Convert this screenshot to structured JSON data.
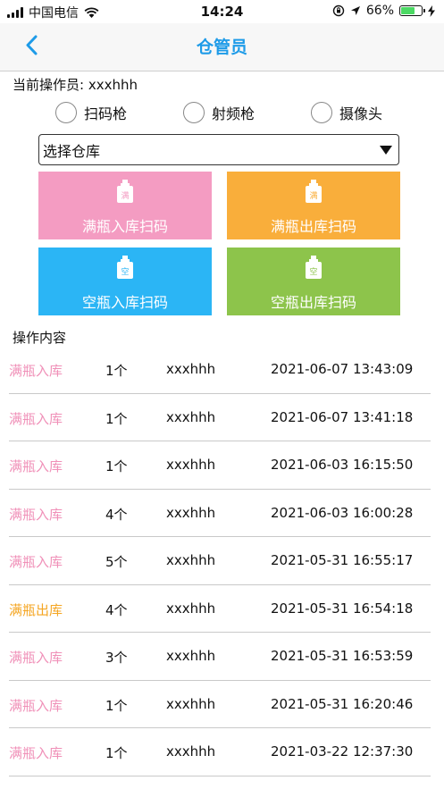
{
  "status_bar": {
    "carrier": "中国电信",
    "time": "14:24",
    "battery": "66%",
    "battery_level": 0.66
  },
  "nav": {
    "title": "仓管员",
    "back_icon": "chevron-left-icon"
  },
  "operator": {
    "label": "当前操作员: xxxhhh"
  },
  "scan_modes": [
    {
      "label": "扫码枪",
      "selected": false
    },
    {
      "label": "射频枪",
      "selected": false
    },
    {
      "label": "摄像头",
      "selected": false
    }
  ],
  "warehouse_select": {
    "value": "选择仓库"
  },
  "tiles": [
    {
      "label": "满瓶入库扫码",
      "badge": "满",
      "color": "#f49cc2"
    },
    {
      "label": "满瓶出库扫码",
      "badge": "满",
      "color": "#f9ae3b"
    },
    {
      "label": "空瓶入库扫码",
      "badge": "空",
      "color": "#2bb5f5"
    },
    {
      "label": "空瓶出库扫码",
      "badge": "空",
      "color": "#8dc44b"
    }
  ],
  "records_section": {
    "title": "操作内容"
  },
  "colors": {
    "in": "#f090b8",
    "out": "#f5a623",
    "accent": "#1e9be8"
  },
  "records": [
    {
      "type": "满瓶入库",
      "kind": "in",
      "qty": "1个",
      "user": "xxxhhh",
      "time": "2021-06-07 13:43:09"
    },
    {
      "type": "满瓶入库",
      "kind": "in",
      "qty": "1个",
      "user": "xxxhhh",
      "time": "2021-06-07 13:41:18"
    },
    {
      "type": "满瓶入库",
      "kind": "in",
      "qty": "1个",
      "user": "xxxhhh",
      "time": "2021-06-03 16:15:50"
    },
    {
      "type": "满瓶入库",
      "kind": "in",
      "qty": "4个",
      "user": "xxxhhh",
      "time": "2021-06-03 16:00:28"
    },
    {
      "type": "满瓶入库",
      "kind": "in",
      "qty": "5个",
      "user": "xxxhhh",
      "time": "2021-05-31 16:55:17"
    },
    {
      "type": "满瓶出库",
      "kind": "out",
      "qty": "4个",
      "user": "xxxhhh",
      "time": "2021-05-31 16:54:18"
    },
    {
      "type": "满瓶入库",
      "kind": "in",
      "qty": "3个",
      "user": "xxxhhh",
      "time": "2021-05-31 16:53:59"
    },
    {
      "type": "满瓶入库",
      "kind": "in",
      "qty": "1个",
      "user": "xxxhhh",
      "time": "2021-05-31 16:20:46"
    },
    {
      "type": "满瓶入库",
      "kind": "in",
      "qty": "1个",
      "user": "xxxhhh",
      "time": "2021-03-22 12:37:30"
    }
  ]
}
